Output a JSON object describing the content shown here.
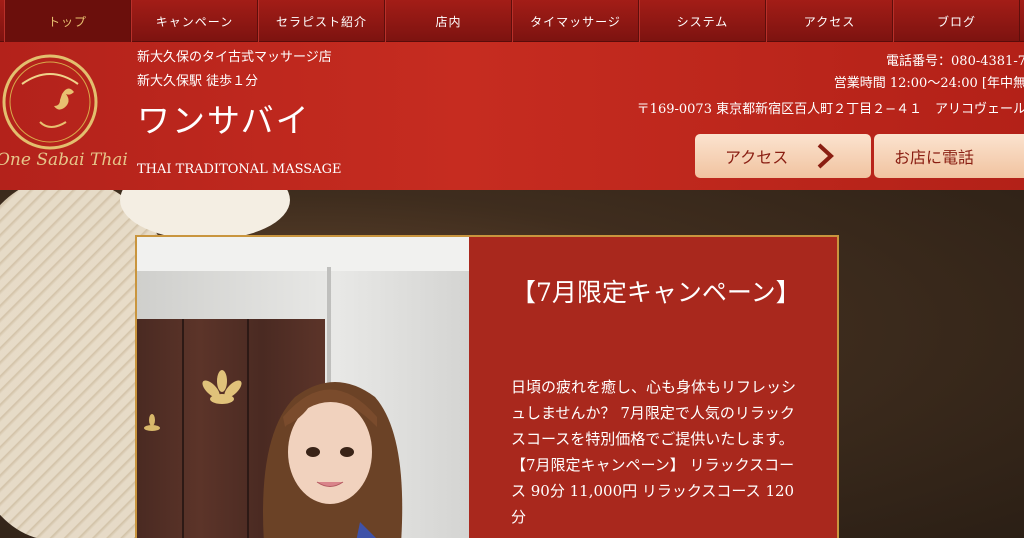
{
  "nav": {
    "items": [
      {
        "label": "トップ",
        "active": true
      },
      {
        "label": "キャンペーン"
      },
      {
        "label": "セラピスト紹介"
      },
      {
        "label": "店内"
      },
      {
        "label": "タイマッサージ"
      },
      {
        "label": "システム"
      },
      {
        "label": "アクセス"
      },
      {
        "label": "ブログ"
      }
    ]
  },
  "header": {
    "logo_text": "One Sabai Thai",
    "tagline1": "新大久保のタイ古式マッサージ店",
    "tagline2": "新大久保駅 徒歩１分",
    "shop_name": "ワンサバイ",
    "subtitle": "THAI TRADITONAL MASSAGE",
    "phone": "電話番号：080-4381-7",
    "hours": "営業時間 12:00〜24:00 [年中無",
    "address": "〒169-0073 東京都新宿区百人町２丁目２−４１　アリコヴェール",
    "access_button": "アクセス",
    "call_button": "お店に電話"
  },
  "campaign": {
    "title": "【7月限定キャンペーン】",
    "body": "日頃の疲れを癒し、心も身体もリフレッシュしませんか？ 7月限定で人気のリラックスコースを特別価格でご提供いたします。 【7月限定キャンペーン】 リラックスコース 90分 11,000円 リラックスコース 120分"
  },
  "colors": {
    "nav_bg": "#8e1813",
    "header_bg": "#c02a1f",
    "gold": "#c9953e",
    "card_bg": "#a9281d",
    "button_bg": "#f6d4b8"
  }
}
